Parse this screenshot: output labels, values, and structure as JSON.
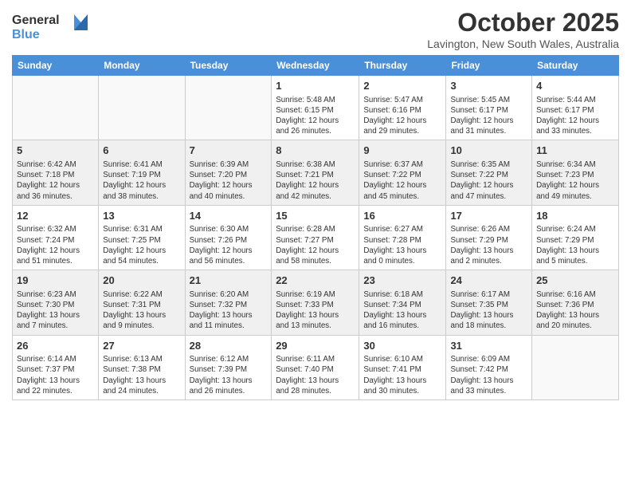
{
  "header": {
    "logo_line1": "General",
    "logo_line2": "Blue",
    "month": "October 2025",
    "location": "Lavington, New South Wales, Australia"
  },
  "weekdays": [
    "Sunday",
    "Monday",
    "Tuesday",
    "Wednesday",
    "Thursday",
    "Friday",
    "Saturday"
  ],
  "weeks": [
    [
      {
        "day": "",
        "info": ""
      },
      {
        "day": "",
        "info": ""
      },
      {
        "day": "",
        "info": ""
      },
      {
        "day": "1",
        "info": "Sunrise: 5:48 AM\nSunset: 6:15 PM\nDaylight: 12 hours\nand 26 minutes."
      },
      {
        "day": "2",
        "info": "Sunrise: 5:47 AM\nSunset: 6:16 PM\nDaylight: 12 hours\nand 29 minutes."
      },
      {
        "day": "3",
        "info": "Sunrise: 5:45 AM\nSunset: 6:17 PM\nDaylight: 12 hours\nand 31 minutes."
      },
      {
        "day": "4",
        "info": "Sunrise: 5:44 AM\nSunset: 6:17 PM\nDaylight: 12 hours\nand 33 minutes."
      }
    ],
    [
      {
        "day": "5",
        "info": "Sunrise: 6:42 AM\nSunset: 7:18 PM\nDaylight: 12 hours\nand 36 minutes."
      },
      {
        "day": "6",
        "info": "Sunrise: 6:41 AM\nSunset: 7:19 PM\nDaylight: 12 hours\nand 38 minutes."
      },
      {
        "day": "7",
        "info": "Sunrise: 6:39 AM\nSunset: 7:20 PM\nDaylight: 12 hours\nand 40 minutes."
      },
      {
        "day": "8",
        "info": "Sunrise: 6:38 AM\nSunset: 7:21 PM\nDaylight: 12 hours\nand 42 minutes."
      },
      {
        "day": "9",
        "info": "Sunrise: 6:37 AM\nSunset: 7:22 PM\nDaylight: 12 hours\nand 45 minutes."
      },
      {
        "day": "10",
        "info": "Sunrise: 6:35 AM\nSunset: 7:22 PM\nDaylight: 12 hours\nand 47 minutes."
      },
      {
        "day": "11",
        "info": "Sunrise: 6:34 AM\nSunset: 7:23 PM\nDaylight: 12 hours\nand 49 minutes."
      }
    ],
    [
      {
        "day": "12",
        "info": "Sunrise: 6:32 AM\nSunset: 7:24 PM\nDaylight: 12 hours\nand 51 minutes."
      },
      {
        "day": "13",
        "info": "Sunrise: 6:31 AM\nSunset: 7:25 PM\nDaylight: 12 hours\nand 54 minutes."
      },
      {
        "day": "14",
        "info": "Sunrise: 6:30 AM\nSunset: 7:26 PM\nDaylight: 12 hours\nand 56 minutes."
      },
      {
        "day": "15",
        "info": "Sunrise: 6:28 AM\nSunset: 7:27 PM\nDaylight: 12 hours\nand 58 minutes."
      },
      {
        "day": "16",
        "info": "Sunrise: 6:27 AM\nSunset: 7:28 PM\nDaylight: 13 hours\nand 0 minutes."
      },
      {
        "day": "17",
        "info": "Sunrise: 6:26 AM\nSunset: 7:29 PM\nDaylight: 13 hours\nand 2 minutes."
      },
      {
        "day": "18",
        "info": "Sunrise: 6:24 AM\nSunset: 7:29 PM\nDaylight: 13 hours\nand 5 minutes."
      }
    ],
    [
      {
        "day": "19",
        "info": "Sunrise: 6:23 AM\nSunset: 7:30 PM\nDaylight: 13 hours\nand 7 minutes."
      },
      {
        "day": "20",
        "info": "Sunrise: 6:22 AM\nSunset: 7:31 PM\nDaylight: 13 hours\nand 9 minutes."
      },
      {
        "day": "21",
        "info": "Sunrise: 6:20 AM\nSunset: 7:32 PM\nDaylight: 13 hours\nand 11 minutes."
      },
      {
        "day": "22",
        "info": "Sunrise: 6:19 AM\nSunset: 7:33 PM\nDaylight: 13 hours\nand 13 minutes."
      },
      {
        "day": "23",
        "info": "Sunrise: 6:18 AM\nSunset: 7:34 PM\nDaylight: 13 hours\nand 16 minutes."
      },
      {
        "day": "24",
        "info": "Sunrise: 6:17 AM\nSunset: 7:35 PM\nDaylight: 13 hours\nand 18 minutes."
      },
      {
        "day": "25",
        "info": "Sunrise: 6:16 AM\nSunset: 7:36 PM\nDaylight: 13 hours\nand 20 minutes."
      }
    ],
    [
      {
        "day": "26",
        "info": "Sunrise: 6:14 AM\nSunset: 7:37 PM\nDaylight: 13 hours\nand 22 minutes."
      },
      {
        "day": "27",
        "info": "Sunrise: 6:13 AM\nSunset: 7:38 PM\nDaylight: 13 hours\nand 24 minutes."
      },
      {
        "day": "28",
        "info": "Sunrise: 6:12 AM\nSunset: 7:39 PM\nDaylight: 13 hours\nand 26 minutes."
      },
      {
        "day": "29",
        "info": "Sunrise: 6:11 AM\nSunset: 7:40 PM\nDaylight: 13 hours\nand 28 minutes."
      },
      {
        "day": "30",
        "info": "Sunrise: 6:10 AM\nSunset: 7:41 PM\nDaylight: 13 hours\nand 30 minutes."
      },
      {
        "day": "31",
        "info": "Sunrise: 6:09 AM\nSunset: 7:42 PM\nDaylight: 13 hours\nand 33 minutes."
      },
      {
        "day": "",
        "info": ""
      }
    ]
  ]
}
